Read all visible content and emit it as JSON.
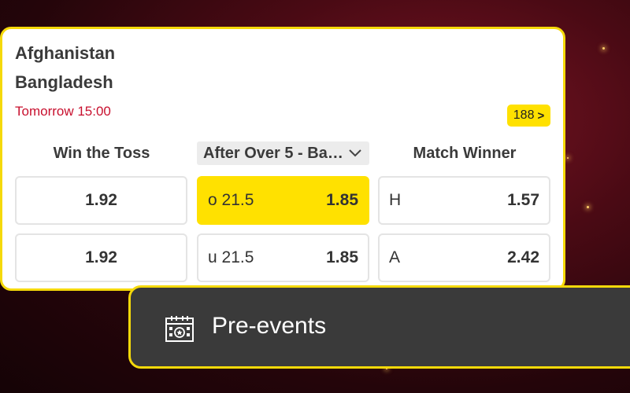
{
  "match": {
    "home_team": "Afghanistan",
    "away_team": "Bangladesh",
    "start_time": "Tomorrow 15:00",
    "more_markets": {
      "count": "188",
      "chevron": ">"
    }
  },
  "markets": [
    {
      "title": "Win the Toss",
      "outcomes": [
        {
          "label": "",
          "odds": "1.92"
        },
        {
          "label": "",
          "odds": "1.92"
        }
      ]
    },
    {
      "title": "After Over 5 - Ba…",
      "dropdown_icon": "chevron-down-icon",
      "outcomes": [
        {
          "label": "o 21.5",
          "odds": "1.85",
          "selected": true
        },
        {
          "label": "u 21.5",
          "odds": "1.85",
          "selected": false
        }
      ]
    },
    {
      "title": "Match Winner",
      "outcomes": [
        {
          "label": "H",
          "odds": "1.57"
        },
        {
          "label": "A",
          "odds": "2.42"
        }
      ]
    }
  ],
  "nav": {
    "label": "Pre-events",
    "icon": "calendar-icon"
  },
  "colors": {
    "accent_yellow": "#ffe100",
    "border_yellow": "#f5d90a",
    "time_red": "#c8102e",
    "bar_dark": "#3a3a3a"
  }
}
